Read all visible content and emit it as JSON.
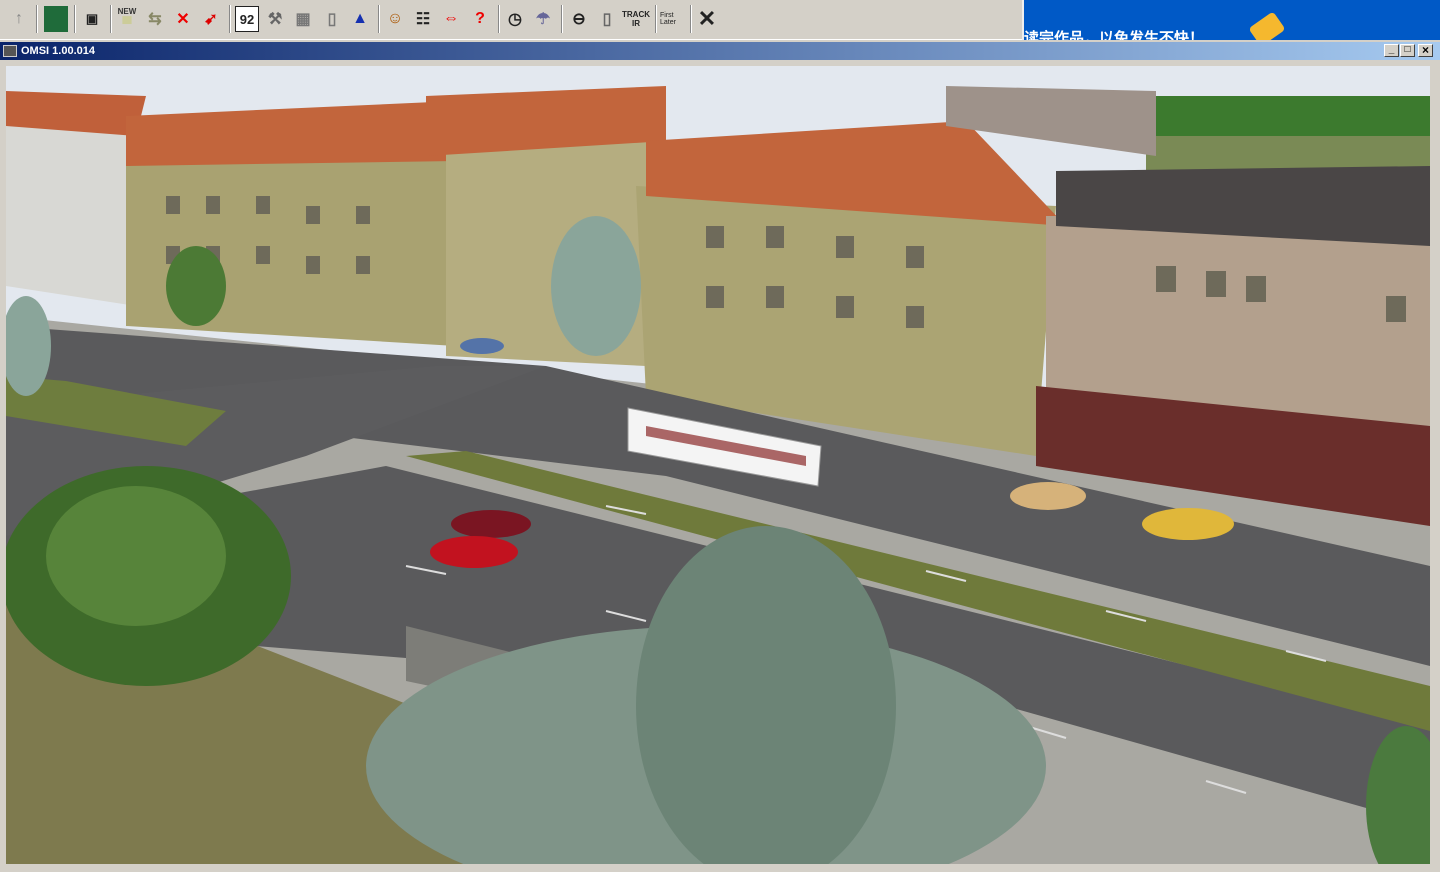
{
  "toolbar": {
    "buttons": [
      {
        "name": "up-arrow",
        "glyph": "↑"
      },
      {
        "name": "map",
        "glyph": "▩"
      },
      {
        "name": "save",
        "glyph": "💾"
      },
      {
        "name": "new-bus",
        "glyph": "🚌"
      },
      {
        "name": "switch-bus",
        "glyph": "⇆"
      },
      {
        "name": "delete-bus",
        "glyph": "✕"
      },
      {
        "name": "place-pointer",
        "glyph": "➹"
      },
      {
        "name": "line-number",
        "glyph": "92"
      },
      {
        "name": "wrench",
        "glyph": "🔧"
      },
      {
        "name": "chip",
        "glyph": "▦"
      },
      {
        "name": "fuel",
        "glyph": "▯"
      },
      {
        "name": "bell",
        "glyph": "▲"
      },
      {
        "name": "driver",
        "glyph": "☺"
      },
      {
        "name": "timetable",
        "glyph": "☷"
      },
      {
        "name": "pc-driver-switch",
        "glyph": "⇔"
      },
      {
        "name": "help-arrow",
        "glyph": "?"
      },
      {
        "name": "clock",
        "glyph": "◷"
      },
      {
        "name": "weather",
        "glyph": "☂"
      },
      {
        "name": "steering-wheel",
        "glyph": "⊖"
      },
      {
        "name": "mouse",
        "glyph": "▯"
      },
      {
        "name": "trackir",
        "glyph": "TRACK IR"
      },
      {
        "name": "first-later",
        "glyph": "☐"
      },
      {
        "name": "close",
        "glyph": "✕"
      }
    ],
    "trackir_label": "TRACK IR",
    "first_label": "First",
    "later_label": "Later"
  },
  "desktop": {
    "banner_text": "读完作品，以免发生不快！"
  },
  "window": {
    "title": "OMSI 1.00.014",
    "minimize": "_",
    "maximize": "□",
    "close": "×"
  },
  "colors": {
    "title_start": "#0a246a",
    "title_end": "#a6caf0",
    "desktop": "#0059c6"
  }
}
